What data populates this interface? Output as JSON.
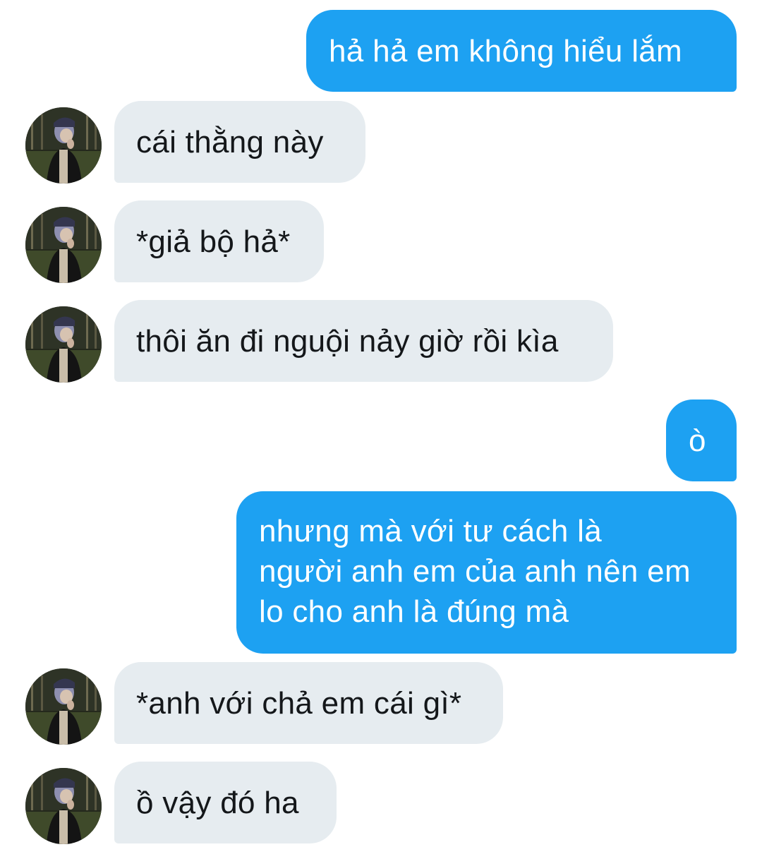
{
  "conversation": {
    "messages": [
      {
        "direction": "sent",
        "lines": [
          "hả hả em không hiểu lắm"
        ]
      },
      {
        "direction": "received",
        "lines": [
          "cái thằng này"
        ]
      },
      {
        "direction": "received",
        "lines": [
          "*giả bộ hả*"
        ]
      },
      {
        "direction": "received",
        "lines": [
          "thôi ăn đi nguội nảy giờ rồi kìa"
        ]
      },
      {
        "direction": "sent",
        "lines": [
          "ò"
        ]
      },
      {
        "direction": "sent",
        "lines": [
          "nhưng mà với tư cách là",
          "người anh em của anh nên em",
          "lo cho anh là đúng mà"
        ]
      },
      {
        "direction": "received",
        "lines": [
          "*anh với chả em cái gì*"
        ]
      },
      {
        "direction": "received",
        "lines": [
          "ồ vậy đó ha"
        ]
      }
    ]
  },
  "colors": {
    "sent_bubble": "#1da1f2",
    "received_bubble": "#e6ecf0",
    "sent_text": "#ffffff",
    "received_text": "#14171a"
  },
  "icons": {
    "avatar": "contact-avatar-photo"
  }
}
